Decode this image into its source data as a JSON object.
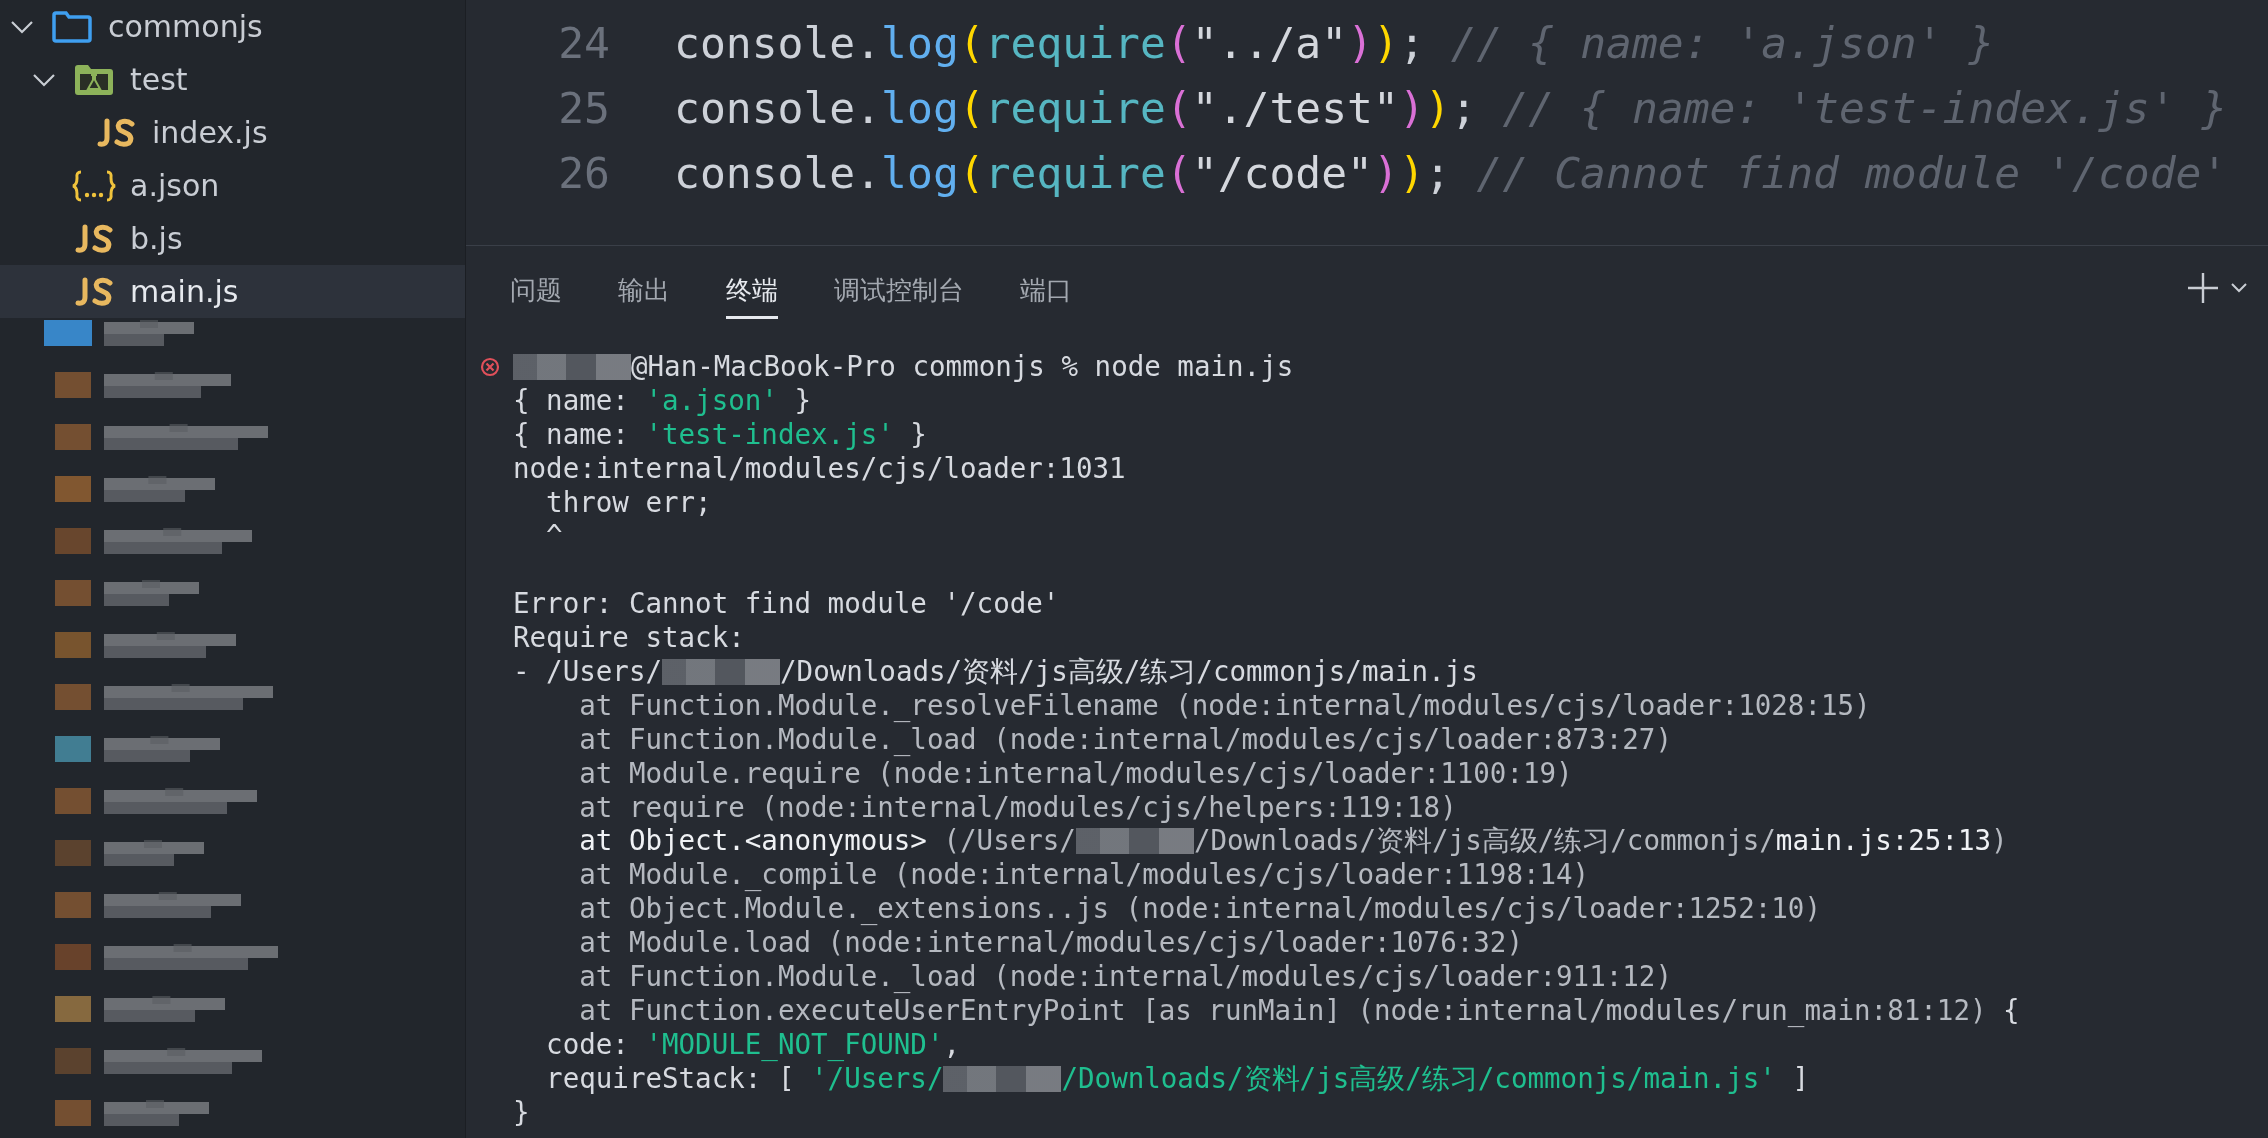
{
  "sidebar": {
    "tree": [
      {
        "name": "commonjs",
        "kind": "folder",
        "expanded": true,
        "selected": false,
        "children": [
          {
            "name": "test",
            "kind": "test-folder",
            "expanded": true,
            "selected": false,
            "children": [
              {
                "name": "index.js",
                "kind": "js",
                "selected": false
              }
            ]
          },
          {
            "name": "a.json",
            "kind": "json",
            "selected": false
          },
          {
            "name": "b.js",
            "kind": "js",
            "selected": false
          },
          {
            "name": "main.js",
            "kind": "js",
            "selected": true
          }
        ]
      }
    ]
  },
  "editor": {
    "lines": [
      {
        "number": "24",
        "tokens": [
          {
            "kind": "plain",
            "text": "console."
          },
          {
            "kind": "func",
            "text": "log"
          },
          {
            "kind": "paren1",
            "text": "("
          },
          {
            "kind": "builtin",
            "text": "require"
          },
          {
            "kind": "paren2",
            "text": "("
          },
          {
            "kind": "string",
            "text": "\"../a\""
          },
          {
            "kind": "paren2",
            "text": ")"
          },
          {
            "kind": "paren1",
            "text": ")"
          },
          {
            "kind": "plain",
            "text": ";"
          },
          {
            "kind": "comment",
            "text": " // { name: 'a.json' }"
          }
        ]
      },
      {
        "number": "25",
        "tokens": [
          {
            "kind": "plain",
            "text": "console."
          },
          {
            "kind": "func",
            "text": "log"
          },
          {
            "kind": "paren1",
            "text": "("
          },
          {
            "kind": "builtin",
            "text": "require"
          },
          {
            "kind": "paren2",
            "text": "("
          },
          {
            "kind": "string",
            "text": "\"./test\""
          },
          {
            "kind": "paren2",
            "text": ")"
          },
          {
            "kind": "paren1",
            "text": ")"
          },
          {
            "kind": "plain",
            "text": ";"
          },
          {
            "kind": "comment",
            "text": " // { name: 'test-index.js' }"
          }
        ]
      },
      {
        "number": "26",
        "tokens": [
          {
            "kind": "plain",
            "text": "console."
          },
          {
            "kind": "func",
            "text": "log"
          },
          {
            "kind": "paren1",
            "text": "("
          },
          {
            "kind": "builtin",
            "text": "require"
          },
          {
            "kind": "paren2",
            "text": "("
          },
          {
            "kind": "string",
            "text": "\"/code\""
          },
          {
            "kind": "paren2",
            "text": ")"
          },
          {
            "kind": "paren1",
            "text": ")"
          },
          {
            "kind": "plain",
            "text": ";"
          },
          {
            "kind": "comment",
            "text": " // Cannot find module '/code'"
          }
        ]
      }
    ]
  },
  "panel": {
    "tabs": [
      {
        "label": "问题",
        "selected": false
      },
      {
        "label": "输出",
        "selected": false
      },
      {
        "label": "终端",
        "selected": true
      },
      {
        "label": "调试控制台",
        "selected": false
      },
      {
        "label": "端口",
        "selected": false
      }
    ],
    "terminal": {
      "lines": [
        {
          "kind": "prompt",
          "error": true,
          "segments": [
            {
              "kind": "redacted"
            },
            {
              "kind": "plain",
              "text": "@Han-MacBook-Pro commonjs % node main.js"
            }
          ]
        },
        {
          "kind": "text",
          "segments": [
            {
              "kind": "plain",
              "text": "{ name: "
            },
            {
              "kind": "string",
              "text": "'a.json'"
            },
            {
              "kind": "plain",
              "text": " }"
            }
          ]
        },
        {
          "kind": "text",
          "segments": [
            {
              "kind": "plain",
              "text": "{ name: "
            },
            {
              "kind": "string",
              "text": "'test-index.js'"
            },
            {
              "kind": "plain",
              "text": " }"
            }
          ]
        },
        {
          "kind": "text",
          "segments": [
            {
              "kind": "plain",
              "text": "node:internal/modules/cjs/loader:1031"
            }
          ]
        },
        {
          "kind": "text",
          "segments": [
            {
              "kind": "plain",
              "text": "  throw err;"
            }
          ]
        },
        {
          "kind": "text",
          "segments": [
            {
              "kind": "plain",
              "text": "  ^"
            }
          ]
        },
        {
          "kind": "blank"
        },
        {
          "kind": "text",
          "segments": [
            {
              "kind": "plain",
              "text": "Error: Cannot find module '/code'"
            }
          ]
        },
        {
          "kind": "text",
          "segments": [
            {
              "kind": "plain",
              "text": "Require stack:"
            }
          ]
        },
        {
          "kind": "text",
          "segments": [
            {
              "kind": "plain",
              "text": "- /Users/"
            },
            {
              "kind": "redacted"
            },
            {
              "kind": "plain",
              "text": "/Downloads/资料/js高级/练习/commonjs/main.js"
            }
          ]
        },
        {
          "kind": "text",
          "segments": [
            {
              "kind": "dim",
              "text": "    at Function.Module._resolveFilename (node:internal/modules/cjs/loader:1028:15)"
            }
          ]
        },
        {
          "kind": "text",
          "segments": [
            {
              "kind": "dim",
              "text": "    at Function.Module._load (node:internal/modules/cjs/loader:873:27)"
            }
          ]
        },
        {
          "kind": "text",
          "segments": [
            {
              "kind": "dim",
              "text": "    at Module.require (node:internal/modules/cjs/loader:1100:19)"
            }
          ]
        },
        {
          "kind": "text",
          "segments": [
            {
              "kind": "dim",
              "text": "    at require (node:internal/modules/cjs/helpers:119:18)"
            }
          ]
        },
        {
          "kind": "text",
          "segments": [
            {
              "kind": "bright",
              "text": "    at Object.<anonymous> "
            },
            {
              "kind": "dim",
              "text": "(/Users/"
            },
            {
              "kind": "redacted"
            },
            {
              "kind": "dim",
              "text": "/Downloads/资料/js高级/练习/commonjs/"
            },
            {
              "kind": "bright",
              "text": "main.js:25:13"
            },
            {
              "kind": "dim",
              "text": ")"
            }
          ]
        },
        {
          "kind": "text",
          "segments": [
            {
              "kind": "dim",
              "text": "    at Module._compile (node:internal/modules/cjs/loader:1198:14)"
            }
          ]
        },
        {
          "kind": "text",
          "segments": [
            {
              "kind": "dim",
              "text": "    at Object.Module._extensions..js (node:internal/modules/cjs/loader:1252:10)"
            }
          ]
        },
        {
          "kind": "text",
          "segments": [
            {
              "kind": "dim",
              "text": "    at Module.load (node:internal/modules/cjs/loader:1076:32)"
            }
          ]
        },
        {
          "kind": "text",
          "segments": [
            {
              "kind": "dim",
              "text": "    at Function.Module._load (node:internal/modules/cjs/loader:911:12)"
            }
          ]
        },
        {
          "kind": "text",
          "segments": [
            {
              "kind": "dim",
              "text": "    at Function.executeUserEntryPoint [as runMain] (node:internal/modules/run_main:81:12)"
            },
            {
              "kind": "plain",
              "text": " {"
            }
          ]
        },
        {
          "kind": "text",
          "segments": [
            {
              "kind": "plain",
              "text": "  code: "
            },
            {
              "kind": "string",
              "text": "'MODULE_NOT_FOUND'"
            },
            {
              "kind": "plain",
              "text": ","
            }
          ]
        },
        {
          "kind": "text",
          "segments": [
            {
              "kind": "plain",
              "text": "  requireStack: [ "
            },
            {
              "kind": "string",
              "text": "'/Users/"
            },
            {
              "kind": "redacted"
            },
            {
              "kind": "string",
              "text": "/Downloads/资料/js高级/练习/commonjs/main.js'"
            },
            {
              "kind": "plain",
              "text": " ]"
            }
          ]
        },
        {
          "kind": "text",
          "segments": [
            {
              "kind": "plain",
              "text": "}"
            }
          ]
        }
      ]
    }
  }
}
